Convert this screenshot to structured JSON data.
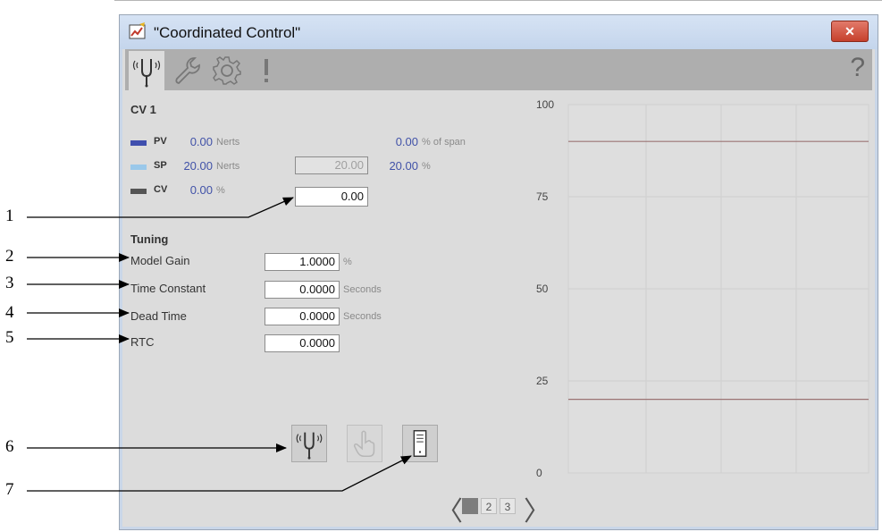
{
  "window": {
    "title": "\"Coordinated Control\"",
    "close_label": "✕",
    "help_label": "?"
  },
  "cv_section": {
    "title": "CV 1",
    "pv": {
      "label": "PV",
      "value": "0.00",
      "unit": "Nerts",
      "span_value": "0.00",
      "span_unit": "% of span",
      "color": "#3f4fae"
    },
    "sp": {
      "label": "SP",
      "value": "20.00",
      "unit": "Nerts",
      "input_value": "20.00",
      "percent_value": "20.00",
      "percent_unit": "%",
      "color": "#9ac8ea"
    },
    "cv": {
      "label": "CV",
      "value": "0.00",
      "unit": "%",
      "input_value": "0.00",
      "color": "#555555"
    }
  },
  "tuning": {
    "title": "Tuning",
    "rows": [
      {
        "label": "Model Gain",
        "value": "1.0000",
        "unit": "%"
      },
      {
        "label": "Time Constant",
        "value": "0.0000",
        "unit": "Seconds"
      },
      {
        "label": "Dead Time",
        "value": "0.0000",
        "unit": "Seconds"
      },
      {
        "label": "RTC",
        "value": "0.0000",
        "unit": ""
      }
    ]
  },
  "chart": {
    "y_ticks": [
      "100",
      "75",
      "50",
      "25",
      "0"
    ],
    "lines": [
      {
        "name": "upper",
        "value": 90,
        "color": "#9b7474"
      },
      {
        "name": "lower",
        "value": 20,
        "color": "#9b7474"
      }
    ],
    "ylim": [
      0,
      100
    ]
  },
  "pager": {
    "pages": [
      "1",
      "2",
      "3"
    ],
    "current": "1",
    "prev": "〈",
    "next": "〉"
  },
  "callouts": [
    "1",
    "2",
    "3",
    "4",
    "5",
    "6",
    "7"
  ]
}
